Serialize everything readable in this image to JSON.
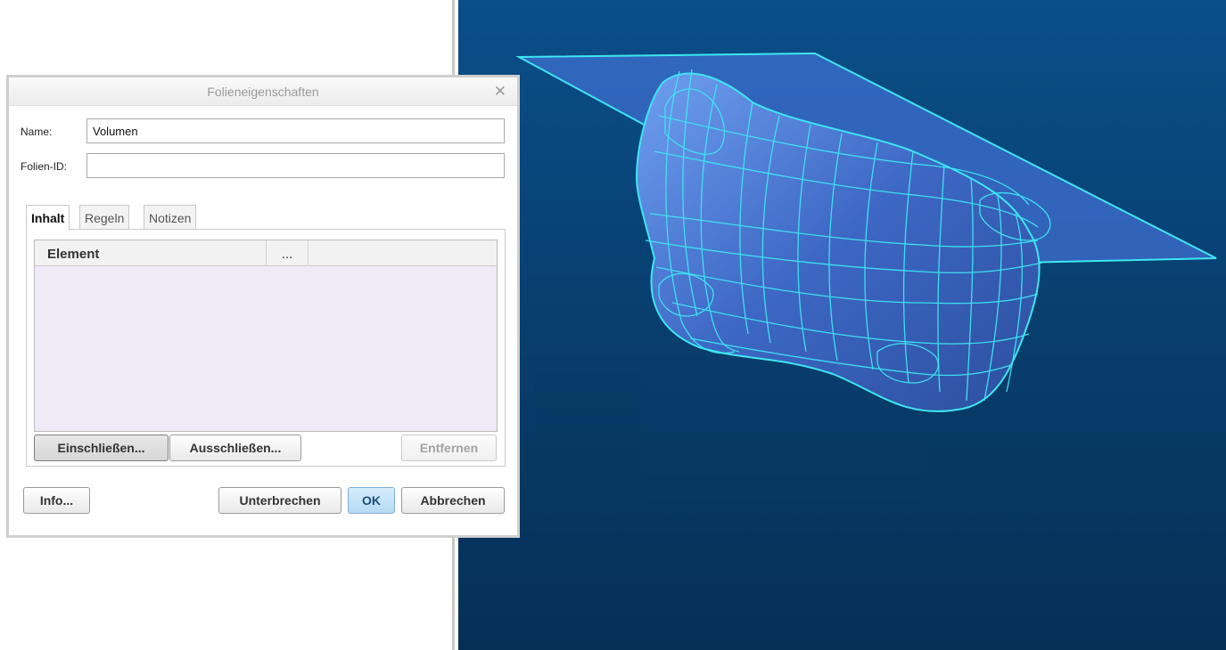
{
  "dialog": {
    "title": "Folieneigenschaften",
    "close_glyph": "✕",
    "name_label": "Name:",
    "name_value": "Volumen",
    "id_label": "Folien-ID:",
    "id_value": "",
    "tabs": [
      "Inhalt",
      "Regeln",
      "Notizen"
    ],
    "active_tab": "Inhalt",
    "table": {
      "columns": [
        "Element",
        "..."
      ],
      "rows": []
    },
    "buttons": {
      "include": "Einschließen...",
      "exclude": "Ausschließen...",
      "remove": "Entfernen",
      "info": "Info...",
      "interrupt": "Unterbrechen",
      "ok": "OK",
      "cancel": "Abbrechen"
    }
  },
  "viewport": {
    "background_top": "#0a4f8a",
    "background_bottom": "#062f56",
    "wire_color": "#3ee6f2",
    "surface_color": "#3f6fd0"
  }
}
